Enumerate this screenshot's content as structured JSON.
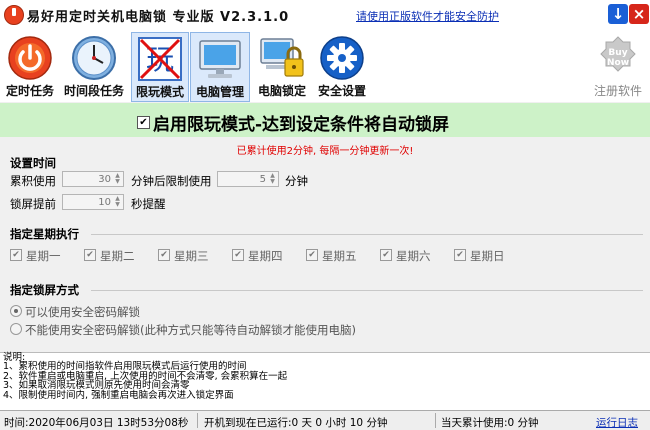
{
  "app": {
    "title": "易好用定时关机电脑锁  专业版  V2.3.1.0",
    "legal_link": "请使用正版软件才能安全防护",
    "minimize": "↓",
    "close": "×"
  },
  "toolbar": [
    {
      "label": "定时任务",
      "icon": "power-icon"
    },
    {
      "label": "时间段任务",
      "icon": "clock-icon"
    },
    {
      "label": "限玩模式",
      "icon": "no-play-icon",
      "glyph": "玩"
    },
    {
      "label": "电脑管理",
      "icon": "monitor-icon"
    },
    {
      "label": "电脑锁定",
      "icon": "computer-lock-icon"
    },
    {
      "label": "安全设置",
      "icon": "gear-icon"
    },
    {
      "label": "注册软件",
      "icon": "buy-now-icon",
      "badge": "Buy\nNow"
    }
  ],
  "banner": {
    "checked": true,
    "text": "启用限玩模式-达到设定条件将自动锁屏"
  },
  "usage_note": "已累计使用2分钟, 每隔一分钟更新一次!",
  "time_settings": {
    "title": "设置时间",
    "accumulated_label": "累积使用",
    "accumulated_value": "30",
    "limit_label": "分钟后限制使用",
    "limit_value": "5",
    "minutes_unit": "分钟",
    "advance_label": "锁屏提前",
    "advance_value": "10",
    "advance_unit": "秒提醒"
  },
  "weekdays": {
    "title": "指定星期执行",
    "days": [
      "星期一",
      "星期二",
      "星期三",
      "星期四",
      "星期五",
      "星期六",
      "星期日"
    ]
  },
  "lock_mode": {
    "title": "指定锁屏方式",
    "options": [
      {
        "label": "可以使用安全密码解锁",
        "selected": true
      },
      {
        "label": "不能使用安全密码解锁(此种方式只能等待自动解锁才能使用电脑)",
        "selected": false
      }
    ]
  },
  "notes": {
    "heading": "说明:",
    "lines": [
      "1、累积使用的时间指软件启用限玩模式后运行使用的时间",
      "2、软件重启或电脑重启, 上次使用的时间不会清零, 会累积算在一起",
      "3、如果取消限玩模式则原先使用时间会清零",
      "4、限制使用时间内, 强制重启电脑会再次进入锁定界面"
    ]
  },
  "status": {
    "time": "时间:2020年06月03日 13时53分08秒",
    "uptime": "开机到现在已运行:0 天 0 小时 10 分钟",
    "today": "当天累计使用:0 分钟",
    "log_link": "运行日志"
  },
  "colors": {
    "banner_bg": "#cdf2c8",
    "note_red": "#e00000",
    "link_blue": "#0b2fb5",
    "active_tool_bg": "#dbe9fb"
  }
}
